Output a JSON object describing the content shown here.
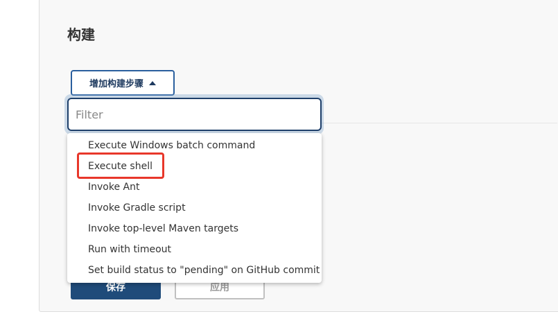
{
  "section": {
    "title": "构建"
  },
  "add_step_button": {
    "label": "增加构建步骤",
    "icon": "caret-up-icon"
  },
  "filter": {
    "placeholder": "Filter",
    "value": ""
  },
  "menu_items": [
    {
      "label": "Execute Windows batch command"
    },
    {
      "label": "Execute shell"
    },
    {
      "label": "Invoke Ant"
    },
    {
      "label": "Invoke Gradle script"
    },
    {
      "label": "Invoke top-level Maven targets"
    },
    {
      "label": "Run with timeout"
    },
    {
      "label": "Set build status to \"pending\" on GitHub commit"
    }
  ],
  "footer": {
    "save_label": "保存",
    "apply_label": "应用"
  },
  "highlight": {
    "target": "Execute shell",
    "color": "#e8372a"
  },
  "colors": {
    "primary": "#1f4b7a",
    "accent_border": "#2a5f9e"
  }
}
